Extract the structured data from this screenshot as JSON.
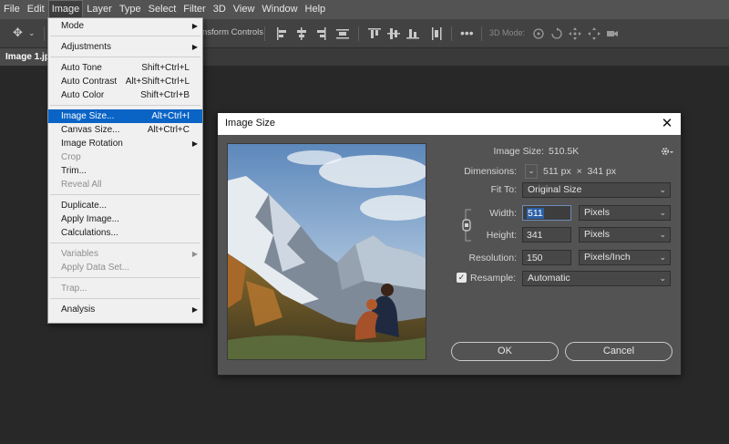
{
  "menubar": [
    "File",
    "Edit",
    "Image",
    "Layer",
    "Type",
    "Select",
    "Filter",
    "3D",
    "View",
    "Window",
    "Help"
  ],
  "options": {
    "transform_label": "nsform Controls",
    "mode3d_label": "3D Mode:"
  },
  "document_tab": "Image 1.jp",
  "image_menu": [
    {
      "label": "Mode",
      "submenu": true
    },
    {
      "sep": true
    },
    {
      "label": "Adjustments",
      "submenu": true
    },
    {
      "sep": true
    },
    {
      "label": "Auto Tone",
      "shortcut": "Shift+Ctrl+L"
    },
    {
      "label": "Auto Contrast",
      "shortcut": "Alt+Shift+Ctrl+L"
    },
    {
      "label": "Auto Color",
      "shortcut": "Shift+Ctrl+B"
    },
    {
      "sep": true
    },
    {
      "label": "Image Size...",
      "shortcut": "Alt+Ctrl+I",
      "selected": true
    },
    {
      "label": "Canvas Size...",
      "shortcut": "Alt+Ctrl+C"
    },
    {
      "label": "Image Rotation",
      "submenu": true
    },
    {
      "label": "Crop",
      "disabled": true
    },
    {
      "label": "Trim..."
    },
    {
      "label": "Reveal All",
      "disabled": true
    },
    {
      "sep": true
    },
    {
      "label": "Duplicate..."
    },
    {
      "label": "Apply Image..."
    },
    {
      "label": "Calculations..."
    },
    {
      "sep": true
    },
    {
      "label": "Variables",
      "submenu": true,
      "disabled": true
    },
    {
      "label": "Apply Data Set...",
      "disabled": true
    },
    {
      "sep": true
    },
    {
      "label": "Trap...",
      "disabled": true
    },
    {
      "sep": true
    },
    {
      "label": "Analysis",
      "submenu": true
    }
  ],
  "dialog": {
    "title": "Image Size",
    "close": "✕",
    "image_size_label": "Image Size:",
    "image_size_value": "510.5K",
    "dimensions_label": "Dimensions:",
    "dimensions_value": "511 px  ×  341 px",
    "fit_to_label": "Fit To:",
    "fit_to_value": "Original Size",
    "width_label": "Width:",
    "width_value": "511",
    "width_unit": "Pixels",
    "height_label": "Height:",
    "height_value": "341",
    "height_unit": "Pixels",
    "resolution_label": "Resolution:",
    "resolution_value": "150",
    "resolution_unit": "Pixels/Inch",
    "resample_label": "Resample:",
    "resample_checked": true,
    "resample_value": "Automatic",
    "ok_label": "OK",
    "cancel_label": "Cancel"
  },
  "colors": {
    "menu_highlight": "#0a64c6",
    "dialog_bg": "#535353",
    "app_bg": "#282828"
  }
}
